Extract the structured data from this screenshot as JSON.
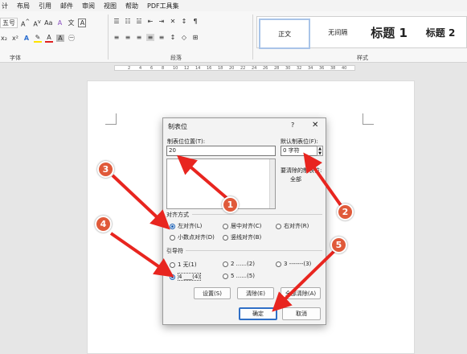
{
  "ribbon": {
    "tabs": [
      "计",
      "布局",
      "引用",
      "邮件",
      "审阅",
      "视图",
      "帮助",
      "PDF工具集"
    ],
    "font_size": "五号",
    "group_font": "字体",
    "group_paragraph": "段落",
    "group_styles": "样式",
    "styles": [
      "正文",
      "无间隔",
      "标题 1",
      "标题 2"
    ]
  },
  "ruler_numbers": [
    "2",
    "4",
    "6",
    "8",
    "10",
    "12",
    "14",
    "16",
    "18",
    "20",
    "22",
    "24",
    "26",
    "28",
    "30",
    "32",
    "34",
    "36",
    "38",
    "40"
  ],
  "dialog": {
    "title": "制表位",
    "help": "?",
    "close": "✕",
    "tab_pos_label": "制表位位置(T):",
    "tab_pos_value": "20",
    "default_label": "默认制表位(F):",
    "default_value": "0 字符",
    "clear_label": "要清除的制表位:",
    "clear_value": "全部",
    "align_label": "对齐方式",
    "align_options": [
      "左对齐(L)",
      "居中对齐(C)",
      "右对齐(R)",
      "小数点对齐(D)",
      "竖线对齐(B)"
    ],
    "leader_label": "引导符",
    "leader_options": [
      "1 无(1)",
      "2 ......(2)",
      "3 -------(3)",
      "4 ___(4)",
      "5 ......(5)"
    ],
    "set_btn": "设置(S)",
    "clear_btn": "清除(E)",
    "clear_all_btn": "全部清除(A)",
    "ok_btn": "确定",
    "cancel_btn": "取消"
  },
  "badges": [
    "1",
    "2",
    "3",
    "4",
    "5"
  ],
  "colors": {
    "badge": "#e05a3a",
    "arrow": "#e8251f",
    "accent": "#2f6fc6"
  }
}
